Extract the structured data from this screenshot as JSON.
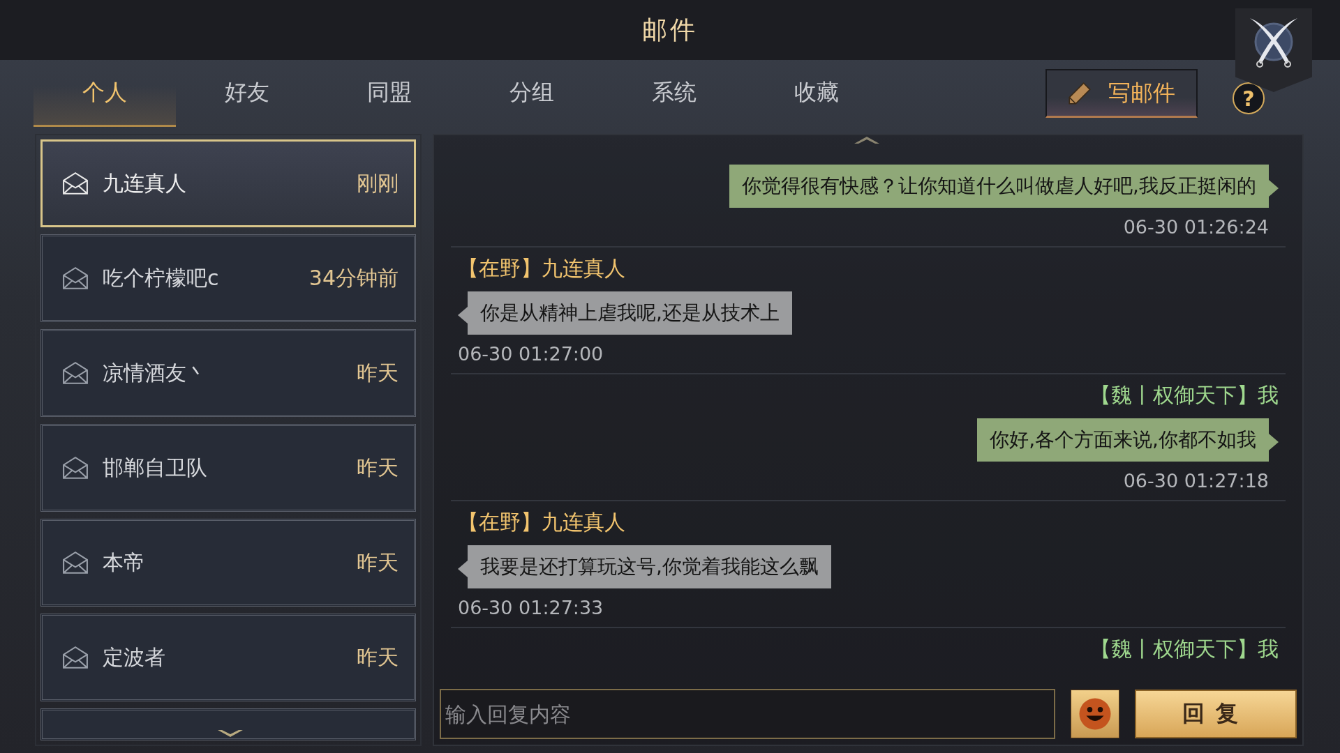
{
  "window": {
    "title": "邮件"
  },
  "tabs": [
    {
      "label": "个人",
      "selected": true
    },
    {
      "label": "好友",
      "selected": false
    },
    {
      "label": "同盟",
      "selected": false
    },
    {
      "label": "分组",
      "selected": false
    },
    {
      "label": "系统",
      "selected": false
    },
    {
      "label": "收藏",
      "selected": false
    }
  ],
  "compose_button": {
    "label": "写邮件"
  },
  "help_button": {
    "label": "?"
  },
  "mail_list": [
    {
      "name": "九连真人",
      "time": "刚刚",
      "selected": true
    },
    {
      "name": "吃个柠檬吧c",
      "time": "34分钟前",
      "selected": false
    },
    {
      "name": "凉情酒友丶",
      "time": "昨天",
      "selected": false
    },
    {
      "name": "邯郸自卫队",
      "time": "昨天",
      "selected": false
    },
    {
      "name": "本帝",
      "time": "昨天",
      "selected": false
    },
    {
      "name": "定波者",
      "time": "昨天",
      "selected": false
    }
  ],
  "messages": [
    {
      "kind": "mine",
      "text": "你觉得很有快感？让你知道什么叫做虐人好吧,我反正挺闲的",
      "time": "06-30 01:26:24"
    },
    {
      "kind": "other",
      "sender": "【在野】九连真人",
      "text": "你是从精神上虐我呢,还是从技术上",
      "time": "06-30 01:27:00"
    },
    {
      "kind": "mine",
      "sender": "【魏丨权御天下】我",
      "text": "你好,各个方面来说,你都不如我",
      "time": "06-30 01:27:18"
    },
    {
      "kind": "other",
      "sender": "【在野】九连真人",
      "text": "我要是还打算玩这号,你觉着我能这么飘",
      "time": "06-30 01:27:33"
    },
    {
      "kind": "mine",
      "sender": "【魏丨权御天下】我"
    }
  ],
  "reply": {
    "placeholder": "输入回复内容",
    "button": "回复"
  }
}
